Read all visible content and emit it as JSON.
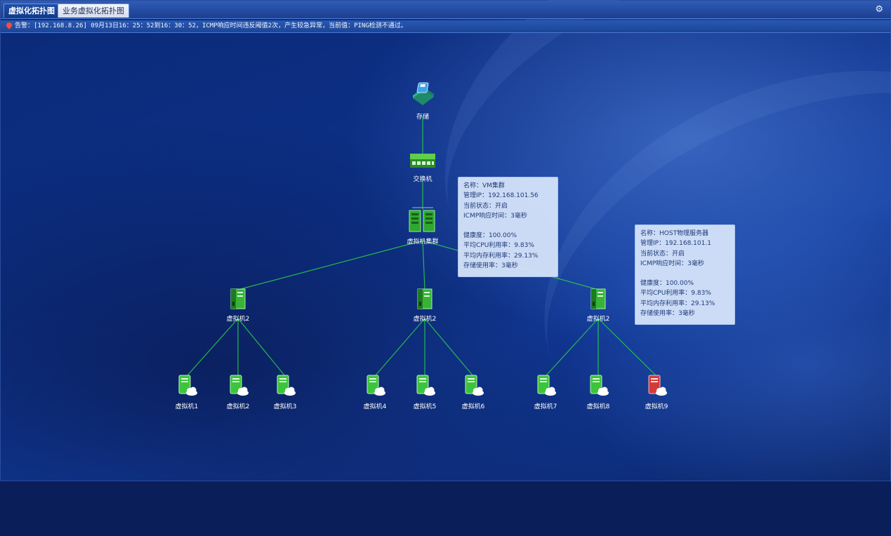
{
  "tabs": [
    {
      "label": "虚拟化拓扑图",
      "active": true
    },
    {
      "label": "业务虚拟化拓扑图",
      "active": false
    }
  ],
  "settings_icon": "gear-icon",
  "alert": {
    "icon": "map-pin-icon",
    "text": "告警：[192.168.8.26] 09月13日16：25：52到16：30：52，ICMP响应时间违反阈值2次，产生较急异常，当前值：PING检测不通过。"
  },
  "topology": {
    "storage": {
      "label": "存储",
      "icon": "storage-icon"
    },
    "switch": {
      "label": "交换机",
      "icon": "switch-icon"
    },
    "cluster": {
      "label": "虚拟机集群",
      "icon": "cluster-icon"
    },
    "hosts": [
      {
        "label": "虚拟机2",
        "icon": "host-server-icon"
      },
      {
        "label": "虚拟机2",
        "icon": "host-server-icon"
      },
      {
        "label": "虚拟机2",
        "icon": "host-server-icon"
      }
    ],
    "vms": [
      {
        "label": "虚拟机1",
        "status": "ok"
      },
      {
        "label": "虚拟机2",
        "status": "ok"
      },
      {
        "label": "虚拟机3",
        "status": "ok"
      },
      {
        "label": "虚拟机4",
        "status": "ok"
      },
      {
        "label": "虚拟机5",
        "status": "ok"
      },
      {
        "label": "虚拟机6",
        "status": "ok"
      },
      {
        "label": "虚拟机7",
        "status": "ok"
      },
      {
        "label": "虚拟机8",
        "status": "ok"
      },
      {
        "label": "虚拟机9",
        "status": "error"
      }
    ]
  },
  "tooltips": {
    "cluster": {
      "lines_top": [
        "名称：VM集群",
        "管理IP：192.168.101.56",
        "当前状态：开启",
        "ICMP响应时间：3毫秒"
      ],
      "lines_bottom": [
        "健康度：100.00%",
        "平均CPU利用率：9.83%",
        "平均内存利用率：29.13%",
        "存储使用率：3毫秒"
      ]
    },
    "host": {
      "lines_top": [
        "名称：HOST物理服务器",
        "管理IP：192.168.101.1",
        "当前状态：开启",
        "ICMP响应时间：3毫秒"
      ],
      "lines_bottom": [
        "健康度：100.00%",
        "平均CPU利用率：9.83%",
        "平均内存利用率：29.13%",
        "存储使用率：3毫秒"
      ]
    }
  },
  "colors": {
    "link": "#2bd14a",
    "ok": "#3cc43c",
    "error": "#d43a3a"
  }
}
